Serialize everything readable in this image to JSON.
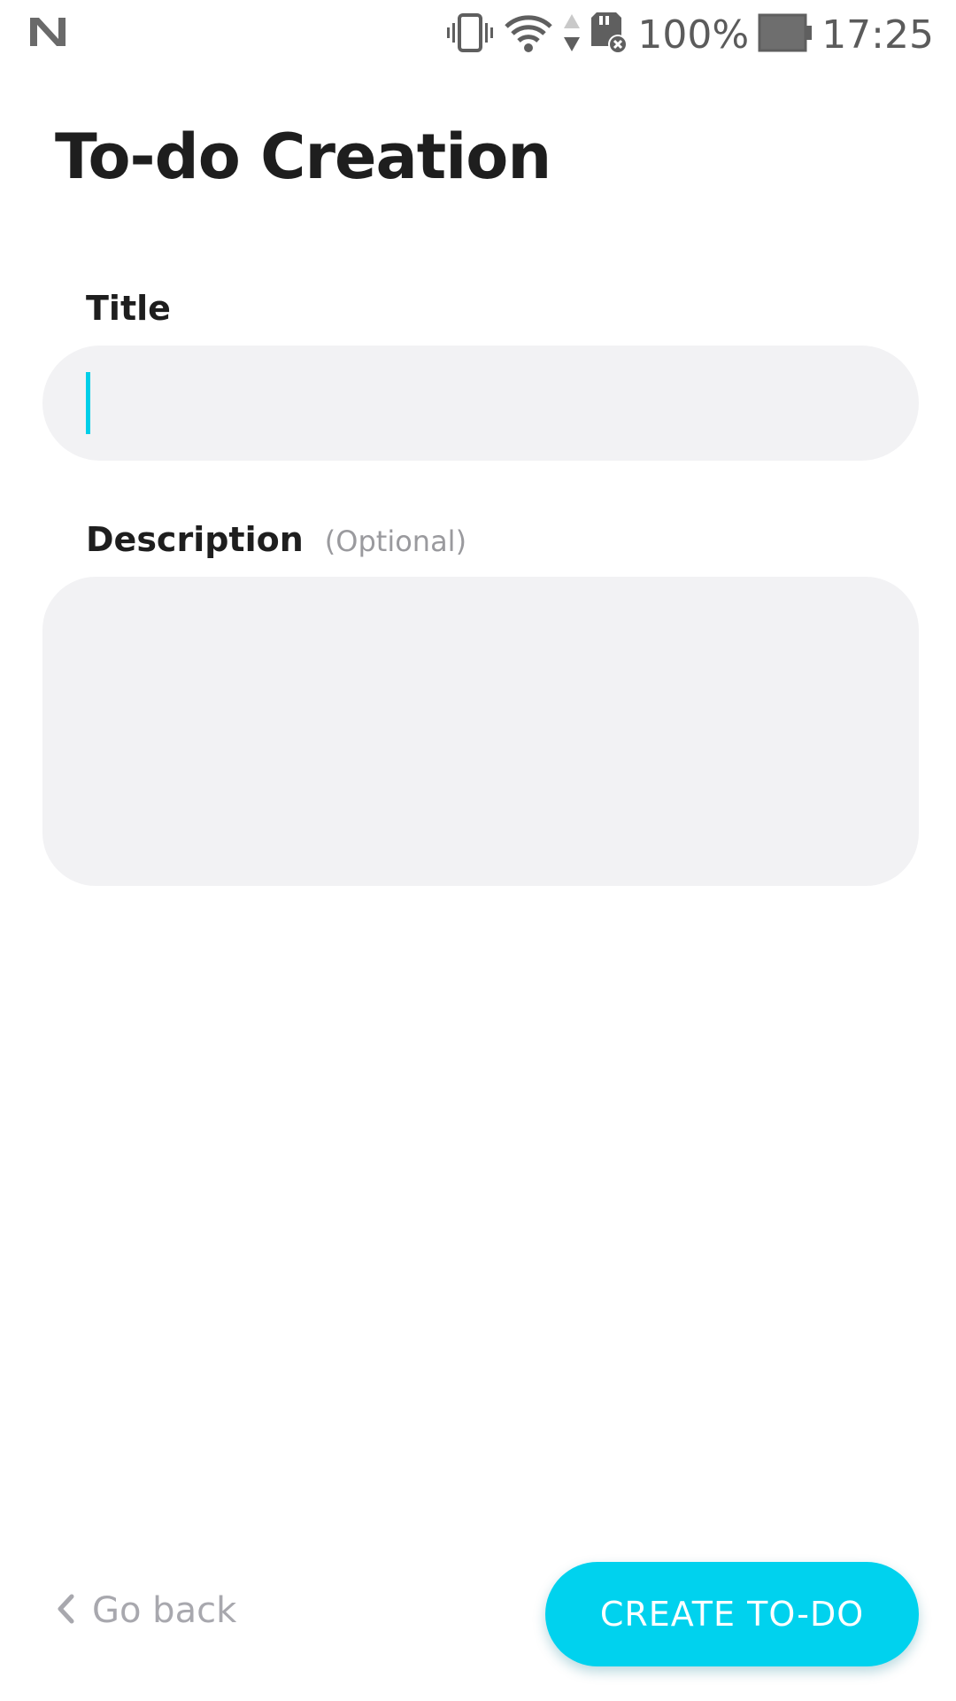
{
  "status_bar": {
    "left_icon": "n-notification-icon",
    "icons": [
      "vibrate-icon",
      "wifi-icon",
      "data-transfer-icon",
      "sd-card-error-icon"
    ],
    "battery_text": "100%",
    "battery_icon": "battery-icon",
    "time": "17:25"
  },
  "page": {
    "title": "To-do Creation"
  },
  "form": {
    "title_label": "Title",
    "title_value": "",
    "description_label": "Description",
    "description_hint": "(Optional)",
    "description_value": ""
  },
  "footer": {
    "back_icon": "chevron-left-icon",
    "back_label": "Go back",
    "create_label": "CREATE TO-DO"
  },
  "colors": {
    "accent": "#00d2ee",
    "caret": "#00cfe8",
    "field_background": "#f2f2f4",
    "text_primary": "#1e1e1e",
    "text_muted": "#a8a8ae"
  }
}
